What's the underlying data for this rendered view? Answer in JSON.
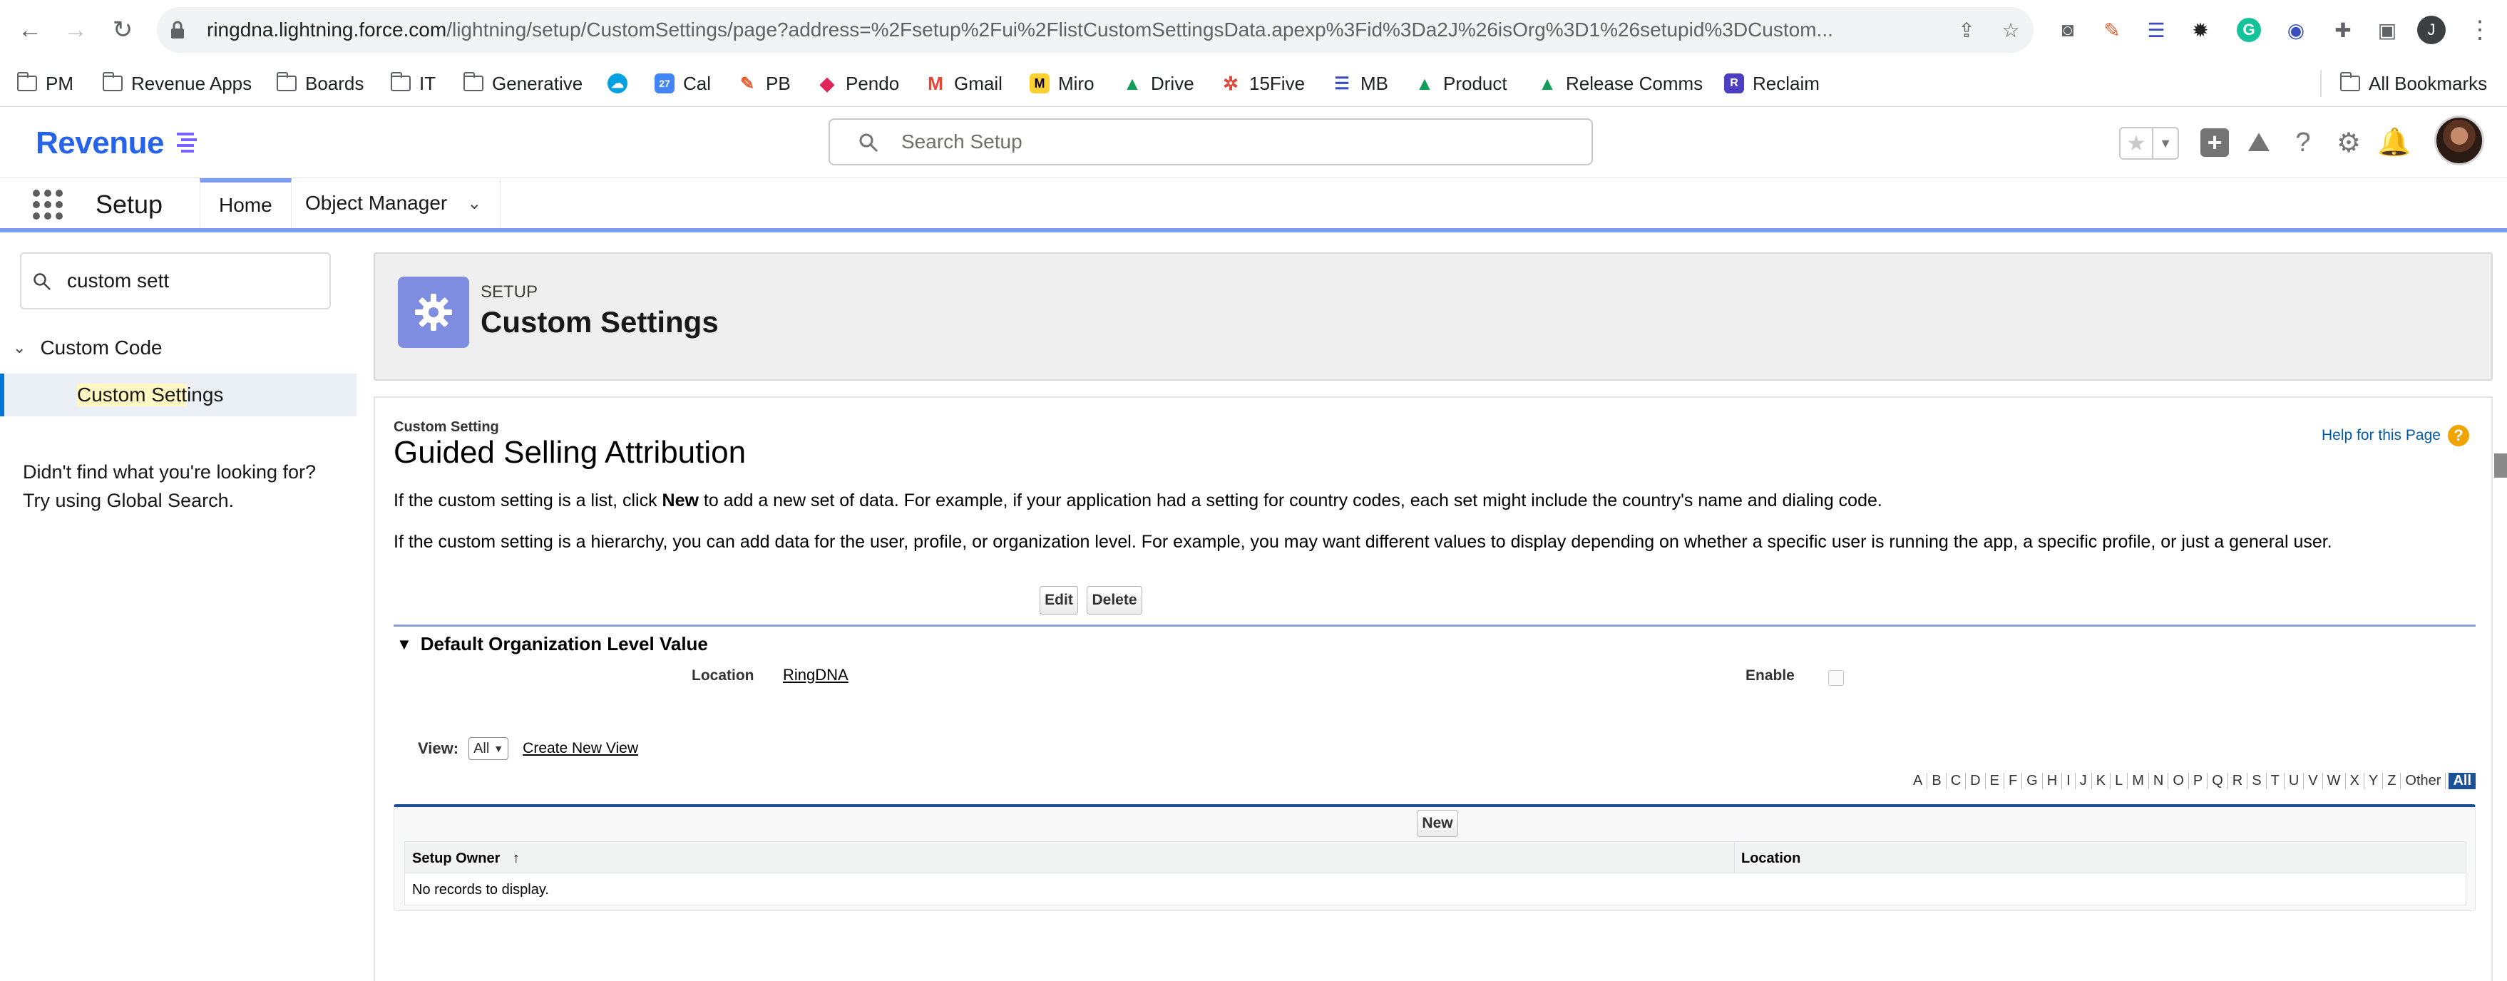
{
  "browser": {
    "url_host": "ringdna.lightning.force.com",
    "url_path": "/lightning/setup/CustomSettings/page?address=%2Fsetup%2Fui%2FlistCustomSettingsData.apexp%3Fid%3Da2J%26isOrg%3D1%26setupid%3DCustom...",
    "profile_initial": "J"
  },
  "bookmarks": [
    {
      "label": "PM",
      "icon": "folder-icon"
    },
    {
      "label": "Revenue Apps",
      "icon": "folder-icon"
    },
    {
      "label": "Boards",
      "icon": "folder-icon"
    },
    {
      "label": "IT",
      "icon": "folder-icon"
    },
    {
      "label": "Generative",
      "icon": "folder-icon"
    },
    {
      "label": "",
      "icon": "salesforce-cloud-icon"
    },
    {
      "label": "Cal",
      "icon": "calendar-icon"
    },
    {
      "label": "PB",
      "icon": "pb-icon"
    },
    {
      "label": "Pendo",
      "icon": "pendo-icon"
    },
    {
      "label": "Gmail",
      "icon": "gmail-icon"
    },
    {
      "label": "Miro",
      "icon": "miro-icon"
    },
    {
      "label": "Drive",
      "icon": "drive-icon"
    },
    {
      "label": "15Five",
      "icon": "15five-icon"
    },
    {
      "label": "MB",
      "icon": "mb-icon"
    },
    {
      "label": "Product",
      "icon": "drive-icon"
    },
    {
      "label": "Release Comms",
      "icon": "drive-icon"
    },
    {
      "label": "Reclaim",
      "icon": "reclaim-icon"
    }
  ],
  "all_bookmarks": "All Bookmarks",
  "header": {
    "logo": "Revenue",
    "search_placeholder": "Search Setup"
  },
  "nav": {
    "app_name": "Setup",
    "tabs": [
      "Home",
      "Object Manager"
    ]
  },
  "sidebar": {
    "quickfind_value": "custom sett",
    "tree_parent": "Custom Code",
    "tree_item_hl": "Custom Sett",
    "tree_item_rest": "ings",
    "not_found_line1": "Didn't find what you're looking for?",
    "not_found_line2": "Try using Global Search."
  },
  "setup_header": {
    "eyebrow": "SETUP",
    "title": "Custom Settings"
  },
  "content": {
    "eyebrow": "Custom Setting",
    "title": "Guided Selling Attribution",
    "help_link": "Help for this Page",
    "para1_a": "If the custom setting is a list, click ",
    "para1_b": "New",
    "para1_c": " to add a new set of data. For example, if your application had a setting for country codes, each set might include the country's name and dialing code.",
    "para2": "If the custom setting is a hierarchy, you can add data for the user, profile, or organization level. For example, you may want different values to display depending on whether a specific user is running the app, a specific profile, or just a general user.",
    "edit_button": "Edit",
    "delete_button": "Delete",
    "section_title": "Default Organization Level Value",
    "location_label": "Location",
    "location_value": "RingDNA",
    "enable_label": "Enable",
    "view_label": "View:",
    "view_selected": "All",
    "create_view": "Create New View",
    "alpha": [
      "A",
      "B",
      "C",
      "D",
      "E",
      "F",
      "G",
      "H",
      "I",
      "J",
      "K",
      "L",
      "M",
      "N",
      "O",
      "P",
      "Q",
      "R",
      "S",
      "T",
      "U",
      "V",
      "W",
      "X",
      "Y",
      "Z",
      "Other",
      "All"
    ],
    "new_button": "New",
    "col_owner": "Setup Owner",
    "col_location": "Location",
    "no_records": "No records to display."
  }
}
